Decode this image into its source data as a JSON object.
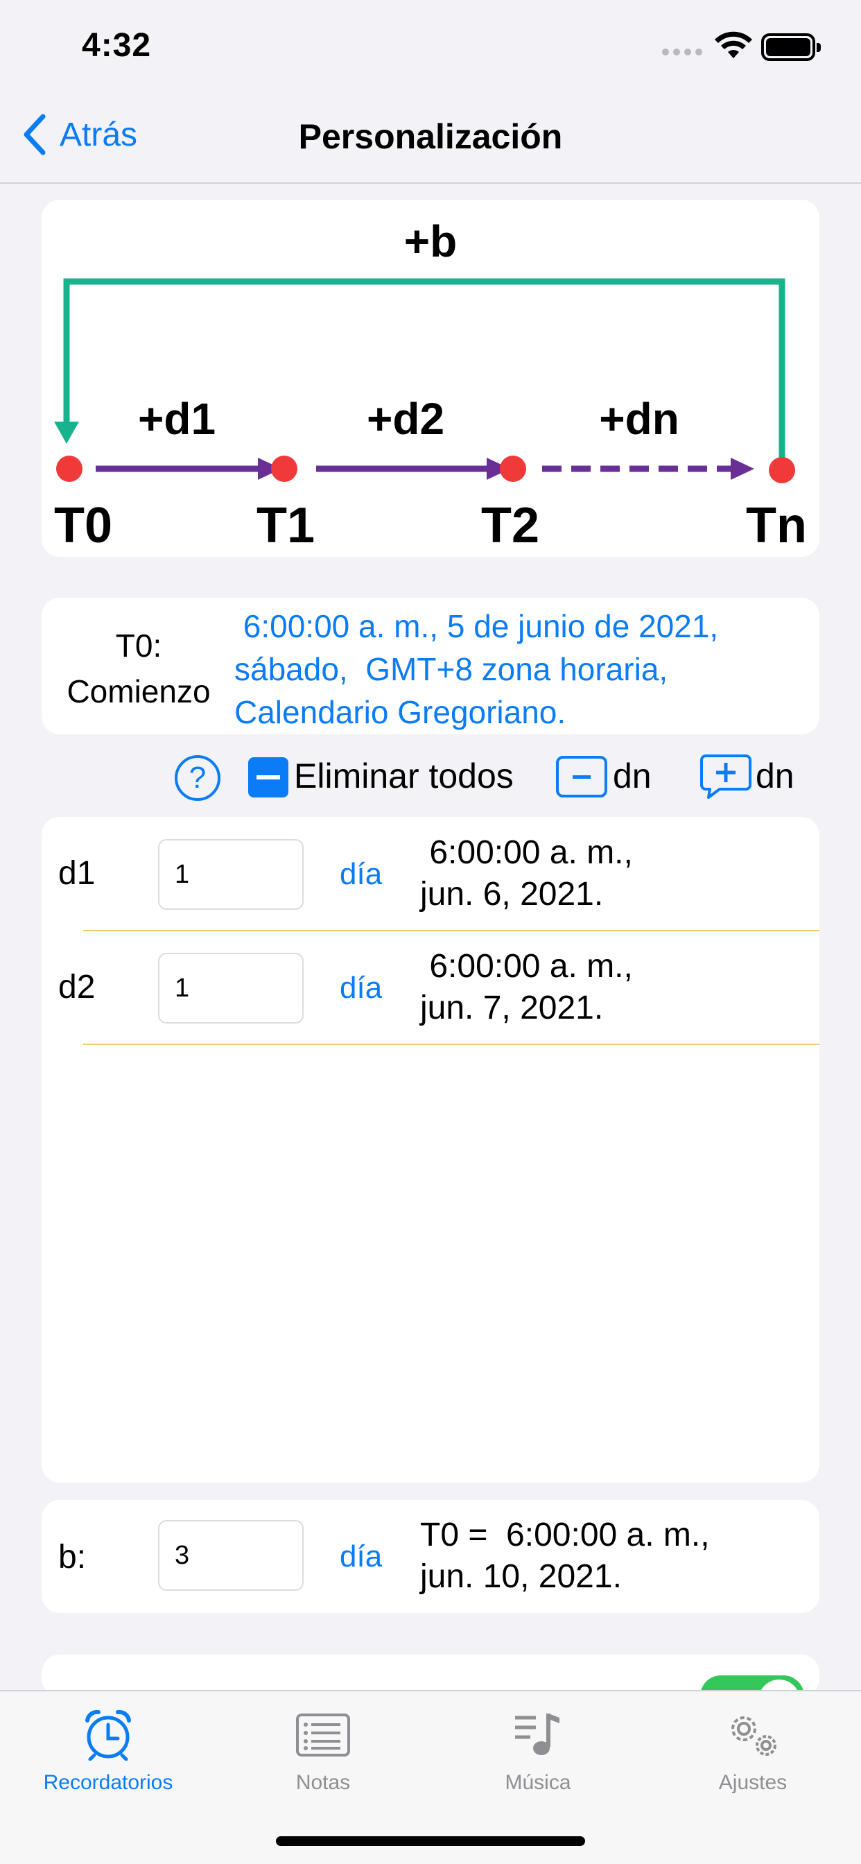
{
  "status_bar": {
    "time": "4:32"
  },
  "nav": {
    "back_label": "Atrás",
    "title": "Personalización"
  },
  "diagram": {
    "top_label": "+b",
    "segment_labels": [
      "+d1",
      "+d2",
      "+dn"
    ],
    "node_labels": [
      "T0",
      "T1",
      "T2",
      "Tn"
    ],
    "colors": {
      "loop": "#17b38c",
      "arrow": "#6a2f96",
      "node": "#f03a3a"
    }
  },
  "start": {
    "label_line1": "T0:",
    "label_line2": "Comienzo",
    "value_line1": " 6:00:00 a. m., 5 de junio de 2021,",
    "value_line2": "sábado,  GMT+8 zona horaria,",
    "value_line3": "Calendario Gregoriano."
  },
  "toolbar": {
    "help_icon": "?",
    "delete_all_label": "Eliminar todos",
    "remove_label": "dn",
    "add_label": "dn"
  },
  "durations": [
    {
      "name": "d1",
      "value": "1",
      "unit": "día",
      "date_line1": " 6:00:00 a. m.,",
      "date_line2": "jun. 6, 2021."
    },
    {
      "name": "d2",
      "value": "1",
      "unit": "día",
      "date_line1": " 6:00:00 a. m.,",
      "date_line2": "jun. 7, 2021."
    }
  ],
  "cycle": {
    "name": "b:",
    "value": "3",
    "unit": "día",
    "date_line1": "T0 =  6:00:00 a. m.,",
    "date_line2": "jun. 10, 2021."
  },
  "tabs": [
    {
      "label": "Recordatorios",
      "icon": "alarm-clock-icon",
      "active": true
    },
    {
      "label": "Notas",
      "icon": "list-icon",
      "active": false
    },
    {
      "label": "Música",
      "icon": "music-note-icon",
      "active": false
    },
    {
      "label": "Ajustes",
      "icon": "gears-icon",
      "active": false
    }
  ],
  "accent_color": "#0a7cf5"
}
